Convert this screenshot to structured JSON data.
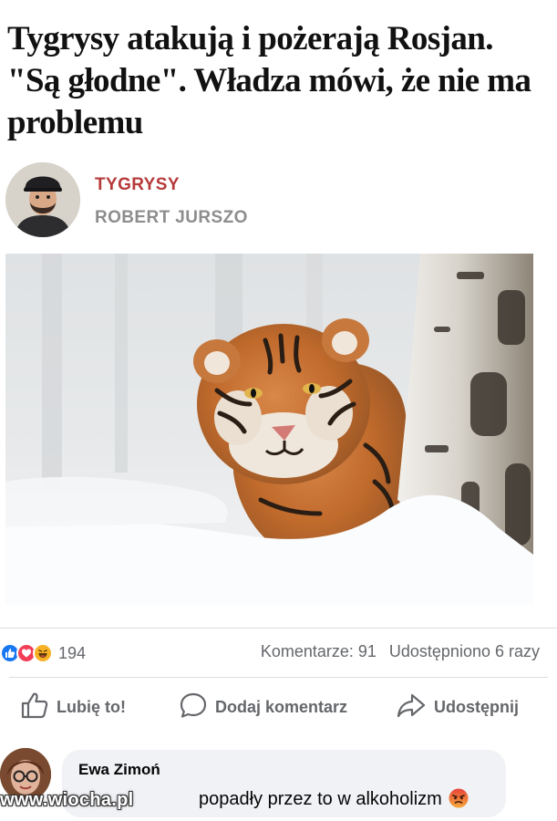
{
  "article": {
    "headline": "Tygrysy atakują i pożerają Rosjan. \"Są głodne\". Władza mówi, że nie ma problemu",
    "category": "TYGRYSY",
    "author": "ROBERT JURSZO",
    "image_icon": "tiger-photo"
  },
  "post": {
    "reactions": [
      "like",
      "love",
      "haha"
    ],
    "reaction_count": "194",
    "comments_count": "Komentarze: 91",
    "shares_count": "Udostępniono 6 razy",
    "actions": {
      "like_label": "Lubię to!",
      "comment_label": "Dodaj komentarz",
      "share_label": "Udostępnij"
    }
  },
  "comment": {
    "author": "Ewa Zimoń",
    "text_visible": "popadły przez to w alkoholizm",
    "emoji": "angry-face"
  },
  "watermark": "www.wiocha.pl",
  "colors": {
    "category": "#b73a3a",
    "like_blue": "#1877f2",
    "love_red": "#f33e58",
    "haha_yellow": "#f7b125",
    "muted_text": "#65676b"
  }
}
